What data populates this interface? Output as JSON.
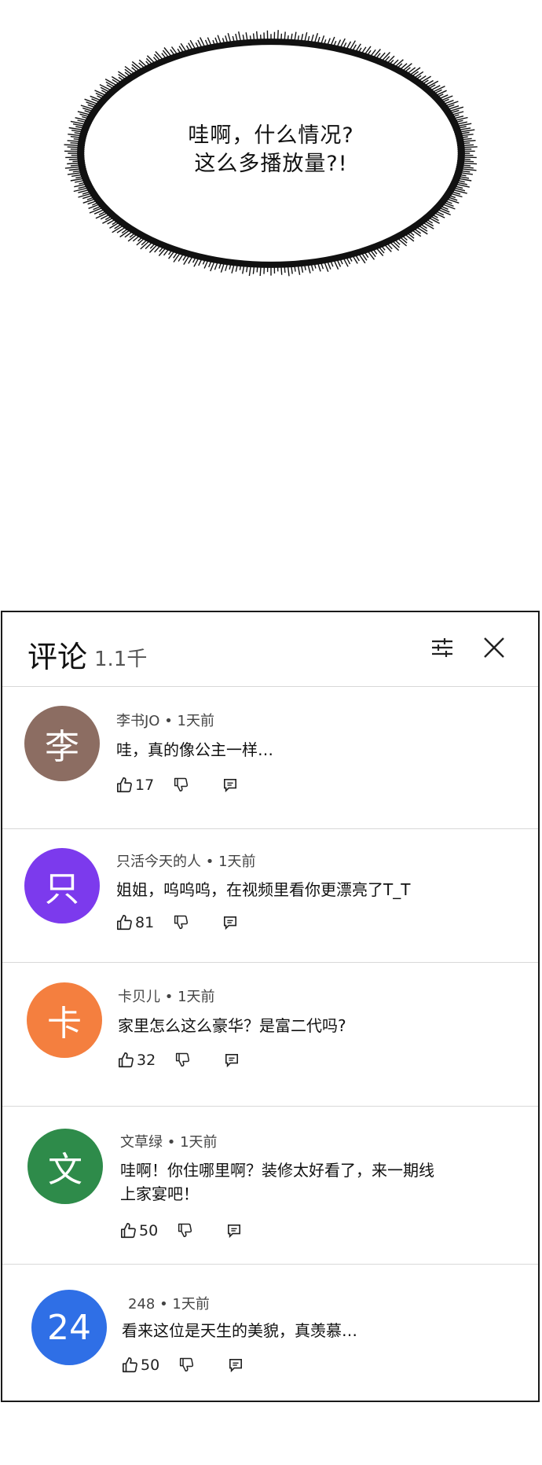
{
  "bubble": {
    "line1": "哇啊，什么情况?",
    "line2": "这么多播放量?!"
  },
  "panel": {
    "title": "评论",
    "count": "1.1千"
  },
  "comments": [
    {
      "avatar_text": "李",
      "avatar_color": "#8c6d62",
      "author": "李书JO",
      "time": "1天前",
      "text": "哇，真的像公主一样…",
      "likes": "17"
    },
    {
      "avatar_text": "只",
      "avatar_color": "#7c3aed",
      "author": "只活今天的人",
      "time": "1天前",
      "text": "姐姐，呜呜呜，在视频里看你更漂亮了T_T",
      "likes": "81"
    },
    {
      "avatar_text": "卡",
      "avatar_color": "#f47f3f",
      "author": "卡贝儿",
      "time": "1天前",
      "text": "家里怎么这么豪华？是富二代吗?",
      "likes": "32"
    },
    {
      "avatar_text": "文",
      "avatar_color": "#2e8b4a",
      "author": "文草绿",
      "time": "1天前",
      "text": "哇啊！你住哪里啊？装修太好看了，来一期线上家宴吧！",
      "likes": "50"
    },
    {
      "avatar_text": "24",
      "avatar_color": "#2f6fe6",
      "author": "248",
      "time": "1天前",
      "text": "看来这位是天生的美貌，真羡慕…",
      "likes": "50"
    }
  ],
  "separator": "•"
}
